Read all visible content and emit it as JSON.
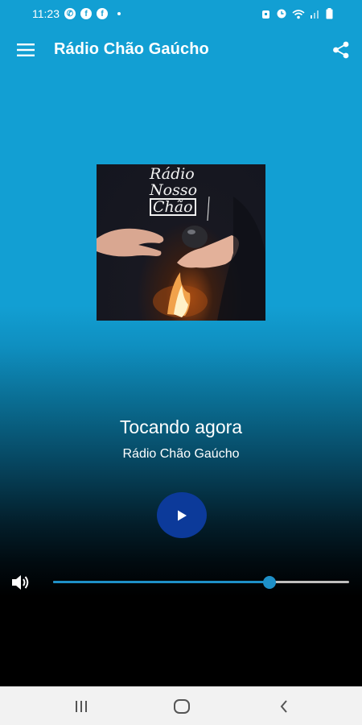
{
  "status_bar": {
    "time": "11:23",
    "notification_icons": [
      "whatsapp-icon",
      "facebook-icon",
      "facebook-icon"
    ],
    "system_icons": [
      "alarm-icon",
      "clock-icon",
      "wifi-icon",
      "signal-icon",
      "battery-icon"
    ]
  },
  "app_bar": {
    "title": "Rádio Chão Gaúcho",
    "menu_icon": "hamburger-menu-icon",
    "share_icon": "share-icon"
  },
  "album_art": {
    "logo_line1": "Rádio",
    "logo_line2": "Nosso",
    "logo_line3": "Chão"
  },
  "player": {
    "now_playing_label": "Tocando agora",
    "station_name": "Rádio Chão Gaúcho",
    "play_icon": "play-icon",
    "volume_icon": "volume-icon",
    "volume_level": 0.73
  },
  "nav_bar": {
    "recents_icon": "recents-icon",
    "home_icon": "home-icon",
    "back_icon": "back-icon"
  },
  "colors": {
    "primary": "#129fd3",
    "play_button": "#0c3a9a",
    "slider_active": "#1e90c8",
    "slider_inactive": "#bfbfbf",
    "nav_bar_bg": "#f2f2f2"
  }
}
